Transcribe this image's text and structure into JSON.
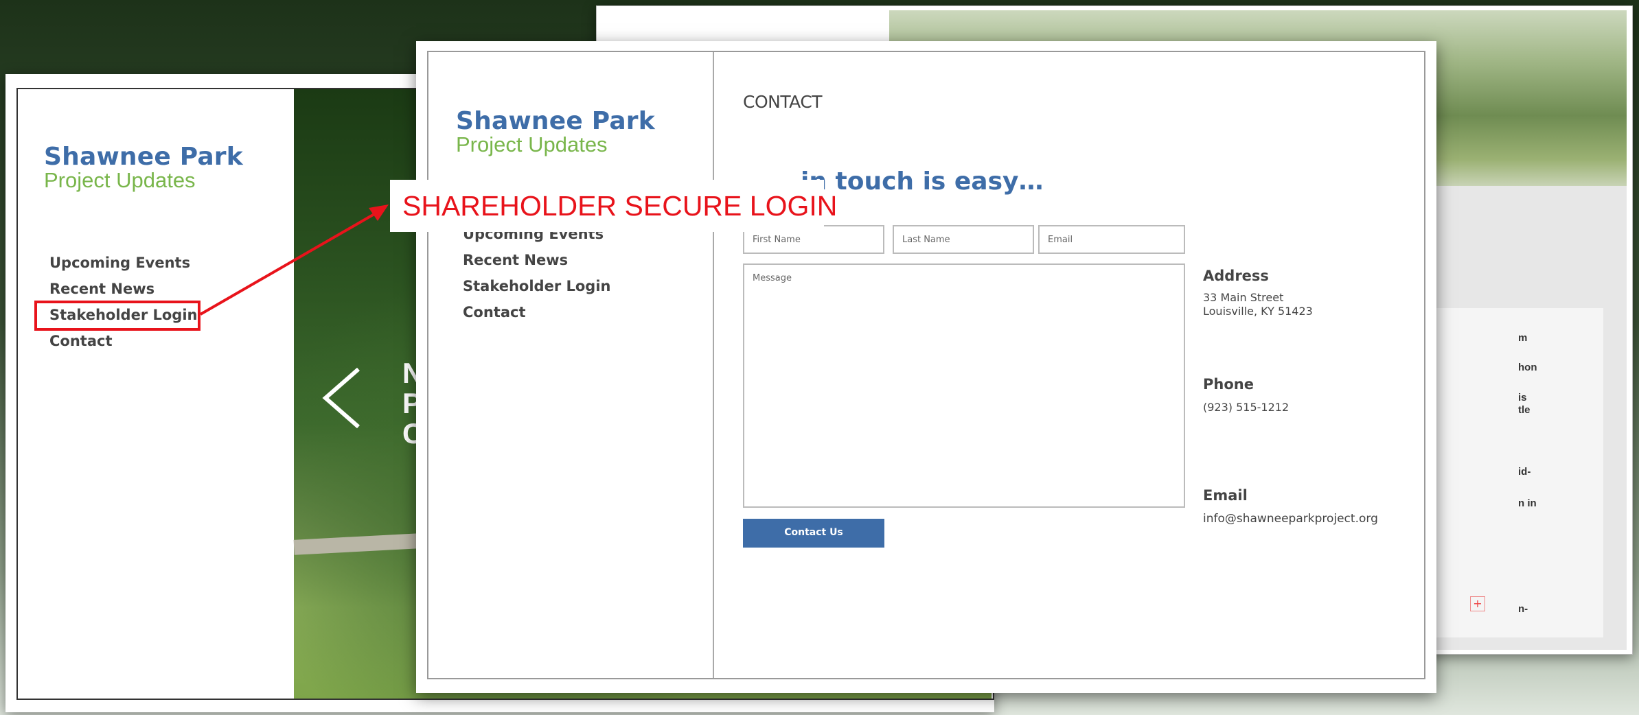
{
  "back_slide": {
    "fragments": [
      "m",
      "hon",
      "is",
      "tle",
      "id-",
      "n in",
      "n-"
    ]
  },
  "left_slide": {
    "brand_title": "Shawnee Park",
    "brand_subtitle": "Project Updates",
    "nav": [
      "Upcoming Events",
      "Recent News",
      "Stakeholder Login",
      "Contact"
    ],
    "hero_caption": [
      "N",
      "P",
      "C"
    ]
  },
  "front_slide": {
    "brand_title": "Shawnee Park",
    "brand_subtitle": "Project Updates",
    "nav": [
      "Upcoming Events",
      "Recent News",
      "Stakeholder Login",
      "Contact"
    ],
    "page_heading": "CONTACT",
    "tagline_visible": "in touch is easy…",
    "form": {
      "first_name_placeholder": "First Name",
      "last_name_placeholder": "Last Name",
      "email_placeholder": "Email",
      "message_placeholder": "Message",
      "submit_label": "Contact Us"
    },
    "contact_info": {
      "address_label": "Address",
      "address_line1": "33 Main Street",
      "address_line2": "Louisville, KY 51423",
      "phone_label": "Phone",
      "phone": "(923) 515-1212",
      "email_label": "Email",
      "email": "info@shawneeparkproject.org"
    }
  },
  "annotation": {
    "callout_text": "SHAREHOLDER SECURE LOGIN",
    "color": "#e8131b"
  }
}
